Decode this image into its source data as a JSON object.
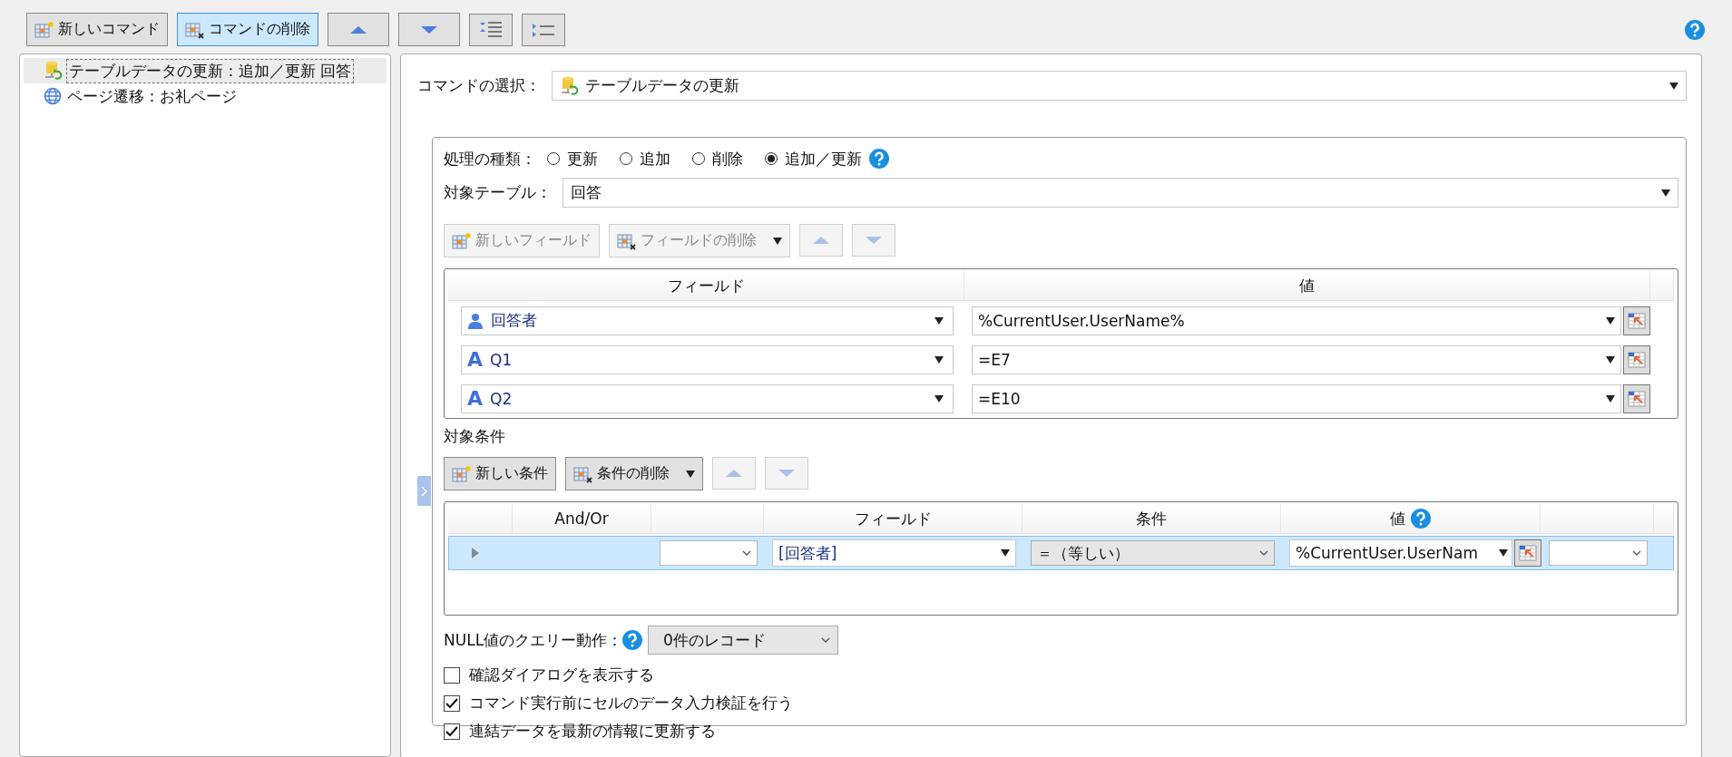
{
  "toolbar": {
    "buttons": [
      {
        "kind": "new",
        "label": "新しいコマンド",
        "selected": false
      },
      {
        "kind": "delete",
        "label": "コマンドの削除",
        "selected": true
      },
      {
        "kind": "up",
        "selected": false
      },
      {
        "kind": "down",
        "selected": false
      },
      {
        "kind": "indent",
        "selected": false
      },
      {
        "kind": "outdent",
        "selected": false
      }
    ]
  },
  "commands": [
    {
      "kind": "table",
      "label": "テーブルデータの更新：追加／更新 回答",
      "selected": true
    },
    {
      "kind": "page",
      "label": "ページ遷移：お礼ページ",
      "selected": false
    }
  ],
  "command_select": {
    "label": "コマンドの選択：",
    "value": "テーブルデータの更新"
  },
  "operation": {
    "label": "処理の種類：",
    "options": [
      {
        "label": "更新",
        "selected": false
      },
      {
        "label": "追加",
        "selected": false
      },
      {
        "label": "削除",
        "selected": false
      },
      {
        "label": "追加／更新",
        "selected": true
      }
    ]
  },
  "target_table": {
    "label": "対象テーブル：",
    "value": "回答"
  },
  "field_toolbar": {
    "buttons": [
      {
        "kind": "new",
        "label": "新しいフィールド",
        "disabled": true
      },
      {
        "kind": "delete",
        "label": "フィールドの削除",
        "disabled": true,
        "menu": true
      },
      {
        "kind": "up",
        "disabled": true
      },
      {
        "kind": "down",
        "disabled": true
      }
    ]
  },
  "fields_table": {
    "columns": [
      "フィールド",
      "値"
    ],
    "rows": [
      {
        "kind": "user",
        "field": "回答者",
        "value": "%CurrentUser.UserName%"
      },
      {
        "kind": "text",
        "icon": "A",
        "field": "Q1",
        "value": "=E7"
      },
      {
        "kind": "text",
        "icon": "A",
        "field": "Q2",
        "value": "=E10"
      }
    ]
  },
  "conditions": {
    "title": "対象条件",
    "toolbar": {
      "buttons": [
        {
          "kind": "new",
          "label": "新しい条件",
          "disabled": false
        },
        {
          "kind": "delete",
          "label": "条件の削除",
          "disabled": false,
          "menu": true
        },
        {
          "kind": "up",
          "disabled": true
        },
        {
          "kind": "down",
          "disabled": true
        }
      ]
    },
    "columns": [
      {
        "kind": "blank"
      },
      {
        "kind": "text",
        "label": "And/Or"
      },
      {
        "kind": "blank"
      },
      {
        "kind": "text",
        "label": "フィールド"
      },
      {
        "kind": "text",
        "label": "条件"
      },
      {
        "kind": "text",
        "label": "値",
        "help": true
      },
      {
        "kind": "blank"
      }
    ],
    "rows": [
      {
        "selected": true,
        "cells": [
          {
            "kind": "indicator"
          },
          {
            "kind": "empty"
          },
          {
            "kind": "combo"
          },
          {
            "kind": "dropdown",
            "value": "[回答者]"
          },
          {
            "kind": "combo",
            "value": "＝（等しい）"
          },
          {
            "kind": "formula",
            "value": "%CurrentUser.UserNam"
          },
          {
            "kind": "combo"
          }
        ]
      }
    ]
  },
  "null_query": {
    "label": "NULL値のクエリー動作：",
    "value": "0件のレコード"
  },
  "options": [
    {
      "label": "確認ダイアログを表示する",
      "checked": false
    },
    {
      "label": "コマンド実行前にセルのデータ入力検証を行う",
      "checked": true
    },
    {
      "label": "連結データを最新の情報に更新する",
      "checked": true
    }
  ]
}
